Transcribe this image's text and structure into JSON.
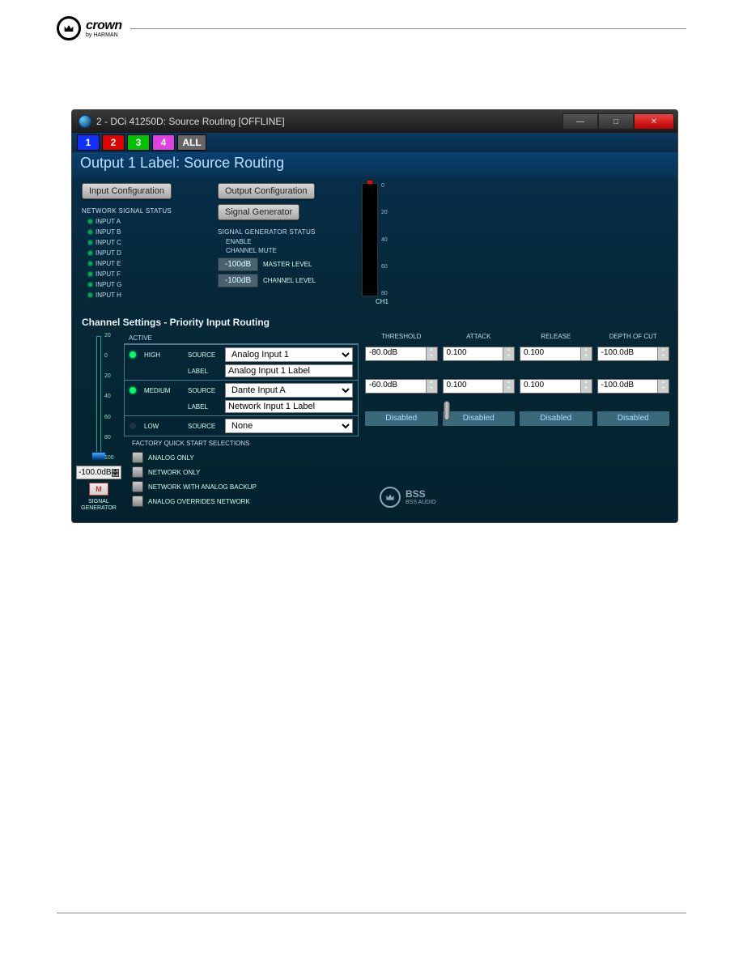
{
  "brand": {
    "name": "crown",
    "sub": "by HARMAN"
  },
  "titlebar": {
    "title": "2 - DCi 41250D: Source Routing [OFFLINE]"
  },
  "tabs": [
    "1",
    "2",
    "3",
    "4",
    "ALL"
  ],
  "page_title": "Output 1 Label: Source Routing",
  "buttons": {
    "input_config": "Input Configuration",
    "output_config": "Output Configuration",
    "signal_generator": "Signal Generator"
  },
  "network_status_header": "NETWORK SIGNAL STATUS",
  "inputs": [
    "INPUT A",
    "INPUT B",
    "INPUT C",
    "INPUT D",
    "INPUT E",
    "INPUT F",
    "INPUT G",
    "INPUT H"
  ],
  "siggen": {
    "status_header": "SIGNAL GENERATOR STATUS",
    "enable": "ENABLE",
    "channel_mute": "CHANNEL MUTE",
    "master_level_label": "MASTER LEVEL",
    "channel_level_label": "CHANNEL LEVEL",
    "master_level": "-100dB",
    "channel_level": "-100dB"
  },
  "meter": {
    "scale": [
      "0",
      "20",
      "40",
      "60",
      "80"
    ],
    "ch": "CH1"
  },
  "priority_title": "Channel Settings - Priority Input Routing",
  "active_label": "ACTIVE",
  "priority_rows": [
    {
      "level": "HIGH",
      "source_label": "SOURCE",
      "source": "Analog Input 1",
      "label_label": "LABEL",
      "label": "Analog Input 1 Label"
    },
    {
      "level": "MEDIUM",
      "source_label": "SOURCE",
      "source": "Dante Input A",
      "label_label": "LABEL",
      "label": "Network Input 1 Label"
    },
    {
      "level": "LOW",
      "source_label": "SOURCE",
      "source": "None"
    }
  ],
  "params": {
    "headers": [
      "THRESHOLD",
      "ATTACK",
      "RELEASE",
      "DEPTH OF CUT"
    ],
    "rows": [
      {
        "threshold": "-80.0dB",
        "attack": "0.100",
        "release": "0.100",
        "depth": "-100.0dB"
      },
      {
        "threshold": "-60.0dB",
        "attack": "0.100",
        "release": "0.100",
        "depth": "-100.0dB"
      }
    ],
    "disabled": "Disabled"
  },
  "fader": {
    "ticks": [
      "20",
      "0",
      "20",
      "40",
      "60",
      "80",
      "100"
    ],
    "value": "-100.0dB",
    "mute": "M",
    "siggen_text": "SIGNAL\nGENERATOR"
  },
  "factory": {
    "header": "FACTORY QUICK START SELECTIONS",
    "opts": [
      "ANALOG ONLY",
      "NETWORK ONLY",
      "NETWORK WITH ANALOG BACKUP",
      "ANALOG OVERRIDES NETWORK"
    ]
  },
  "bss": "BSS AUDIO"
}
